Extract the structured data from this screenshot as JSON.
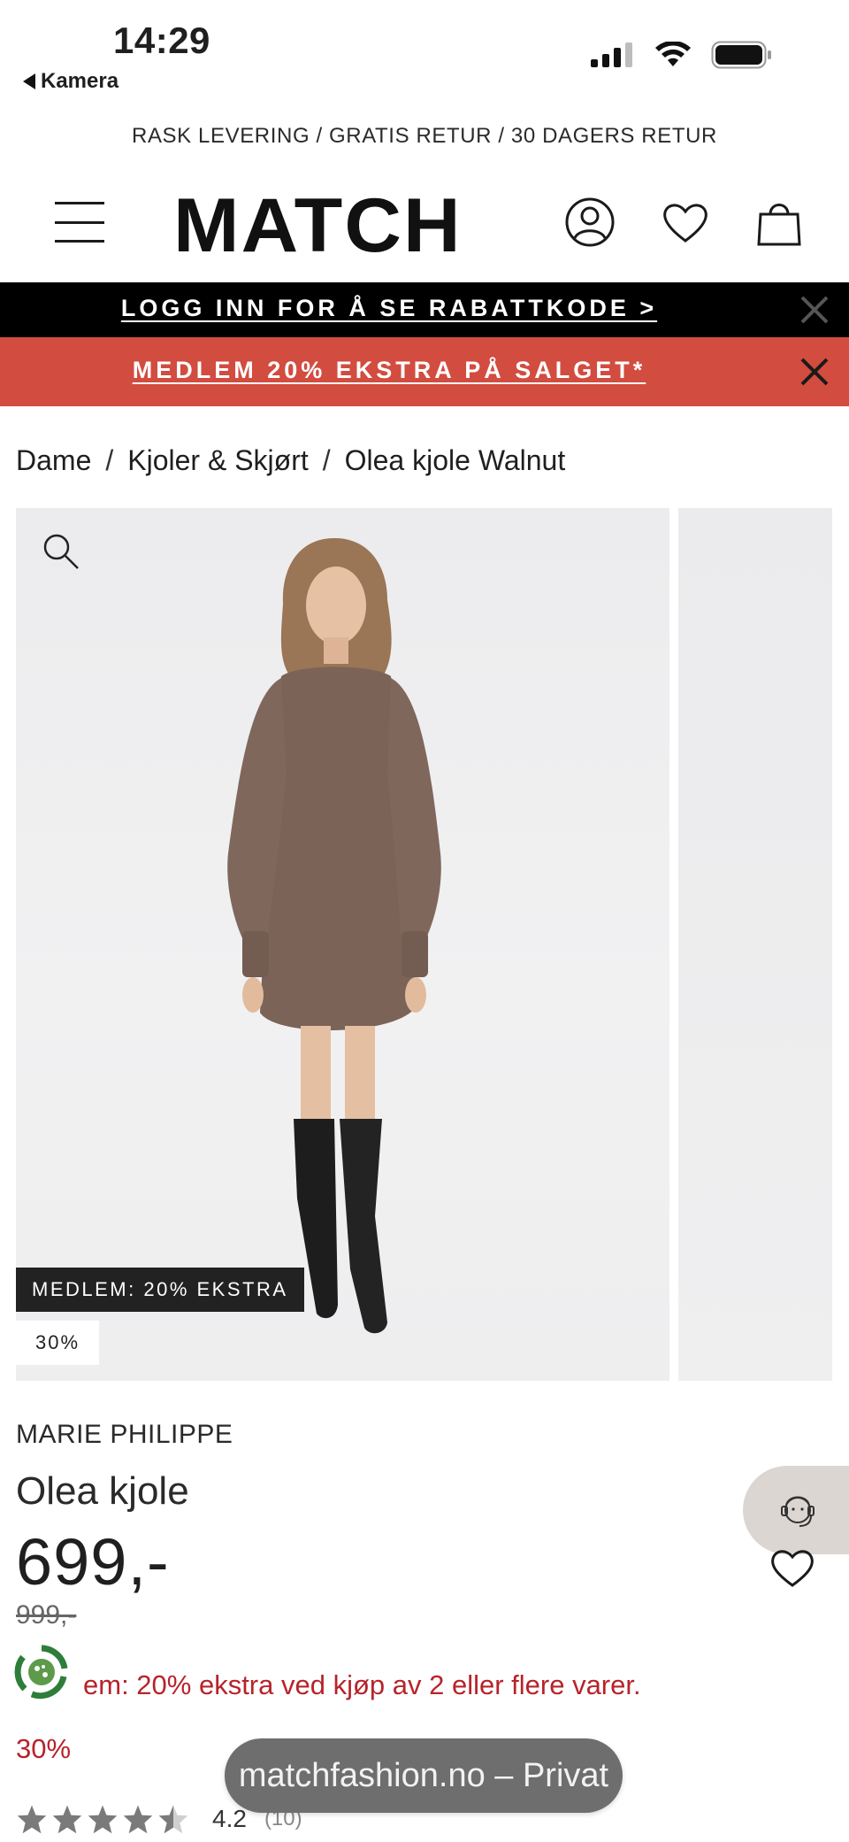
{
  "status_bar": {
    "time": "14:29",
    "back_app": "Kamera"
  },
  "promo_line": "RASK LEVERING / GRATIS RETUR / 30 DAGERS RETUR",
  "header": {
    "logo": "MATCH",
    "icons": [
      "menu-icon",
      "account-icon",
      "heart-icon",
      "shopping-bag-icon"
    ]
  },
  "banners": {
    "login": "LOGG INN FOR Å SE RABATTKODE >",
    "member_sale": "MEDLEM 20% EKSTRA PÅ SALGET*"
  },
  "breadcrumb": {
    "items": [
      "Dame",
      "Kjoler & Skjørt",
      "Olea kjole Walnut"
    ],
    "separator": "/"
  },
  "gallery": {
    "badge_member": "MEDLEM: 20% EKSTRA",
    "badge_percent": "30%"
  },
  "product": {
    "brand": "MARIE PHILIPPE",
    "name": "Olea kjole",
    "price": "699,-",
    "old_price": "999,-",
    "member_offer": "em: 20% ekstra ved kjøp av 2 eller flere varer.",
    "discount": "30%",
    "rating_value": "4.2",
    "rating_count": "(10)",
    "rating_stars": 4.2
  },
  "browser": {
    "url_pill": "matchfashion.no – Privat"
  },
  "colors": {
    "banner_red": "#d24c40",
    "banner_black": "#000000",
    "sale_red": "#b7232a",
    "chat_bg": "#dcd6d2",
    "eco_green": "#2f7d3a"
  }
}
